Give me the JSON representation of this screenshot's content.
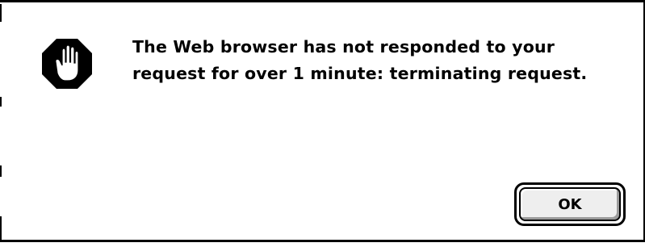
{
  "dialog": {
    "icon": "stop-hand-icon",
    "message_lines": [
      "The Web browser has not responded to your",
      "request for over 1 minute: terminating request."
    ],
    "ok_label": "OK"
  },
  "colors": {
    "background": "#ffffff",
    "border": "#000000",
    "button_fill": "#eeeeee"
  }
}
